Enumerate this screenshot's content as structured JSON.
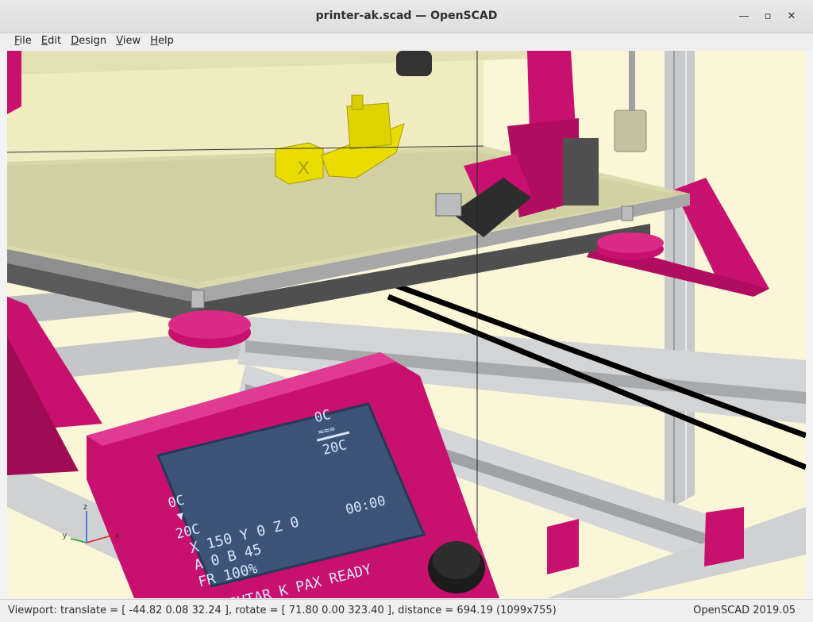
{
  "window": {
    "title": "printer-ak.scad — OpenSCAD",
    "minimize_icon": "minimize-icon",
    "maximize_icon": "maximize-icon",
    "close_icon": "close-icon"
  },
  "menu": [
    {
      "mnemonic": "F",
      "rest": "ile"
    },
    {
      "mnemonic": "E",
      "rest": "dit"
    },
    {
      "mnemonic": "D",
      "rest": "esign"
    },
    {
      "mnemonic": "V",
      "rest": "iew"
    },
    {
      "mnemonic": "H",
      "rest": "elp"
    }
  ],
  "viewport": {
    "background": "#fbf6d7",
    "frame_color": "#c8106e",
    "extrusion_color": "#cfd1d3",
    "model_color": "#e8dc00",
    "lcd": {
      "temp_top_right": "0C",
      "temp_top_right_target": "20C",
      "hotend_left": "0C",
      "hotend_left_target": "20C",
      "position": "X 150  Y 0  Z 0",
      "timer": "00:00",
      "ab_line": "A 0 B 45",
      "feedrate": "FR 100%",
      "message": "ASHTAR K PAX READY"
    },
    "axes": {
      "x": "x",
      "y": "y",
      "z": "z"
    }
  },
  "status": {
    "left": "Viewport: translate = [ -44.82 0.08 32.24 ], rotate = [ 71.80 0.00 323.40 ], distance = 694.19 (1099x755)",
    "right": "OpenSCAD 2019.05"
  }
}
